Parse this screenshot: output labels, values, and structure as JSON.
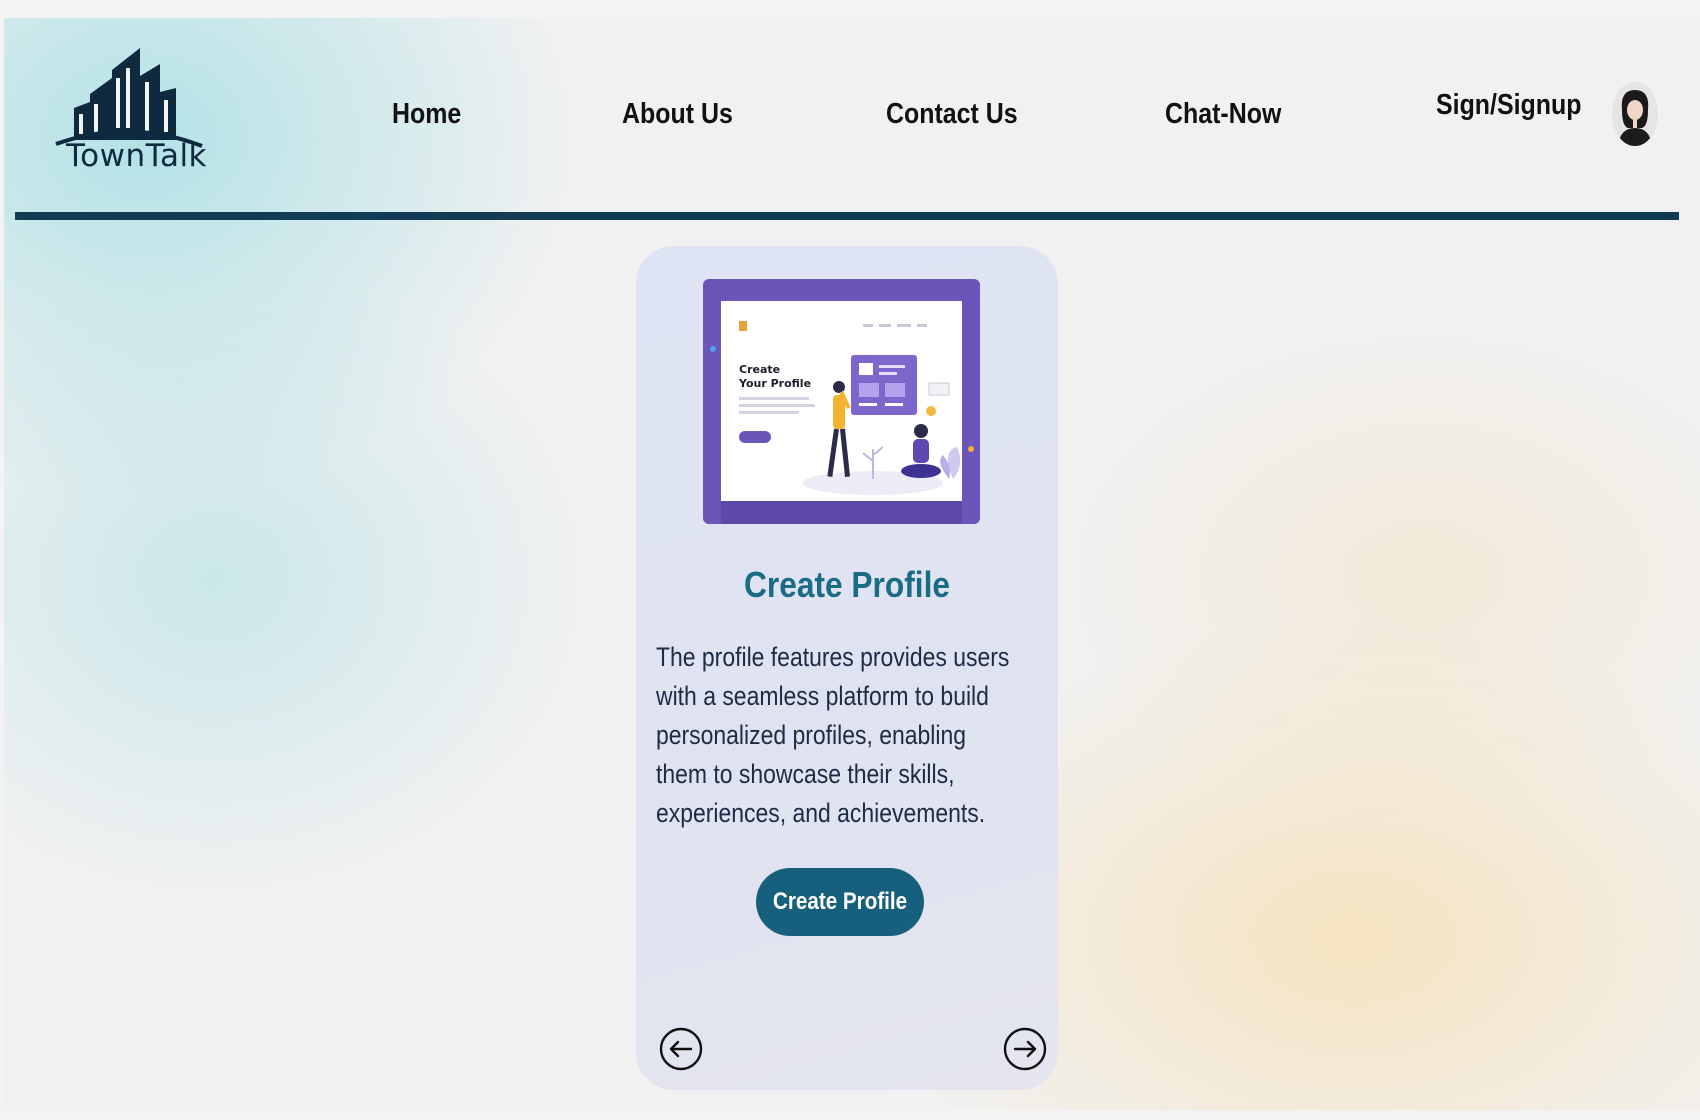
{
  "brand": {
    "name": "TownTalk"
  },
  "nav": {
    "home": "Home",
    "about": "About Us",
    "contact": "Contact Us",
    "chat": "Chat-Now",
    "sign": "Sign/Signup"
  },
  "card": {
    "illustration": {
      "heading_line1": "Create",
      "heading_line2": "Your Profile"
    },
    "title": "Create Profile",
    "description": "The  profile features provides users with a seamless platform to build personalized profiles, enabling them to showcase their skills, experiences, and achievements.",
    "button_label": "Create Profile"
  },
  "icons": {
    "logo": "city-buildings-logo",
    "avatar": "user-avatar",
    "prev": "arrow-left-circle-icon",
    "next": "arrow-right-circle-icon"
  },
  "colors": {
    "primary": "#16607e",
    "title": "#1a6b86",
    "divider": "#123c54",
    "illustration_frame": "#6b55b8"
  }
}
